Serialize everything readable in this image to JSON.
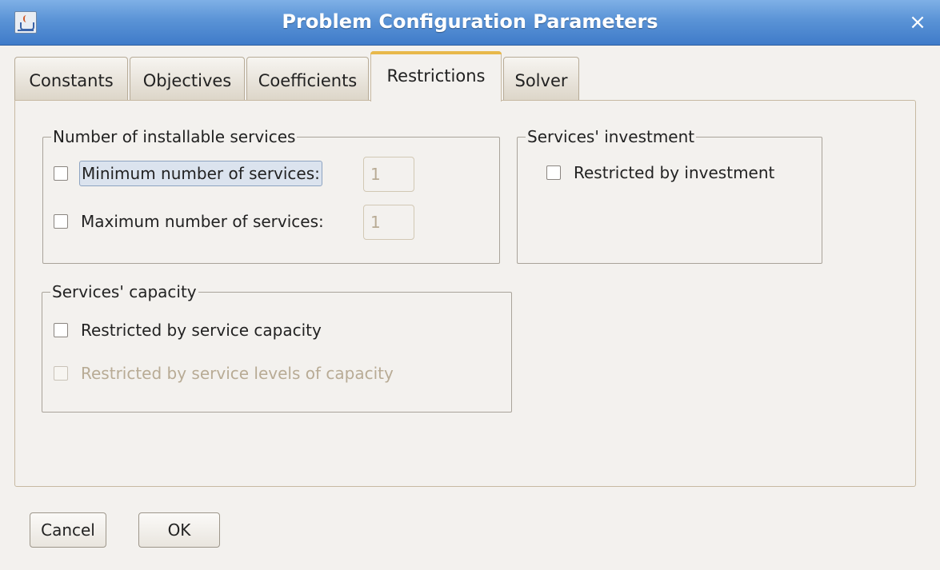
{
  "window": {
    "title": "Problem Configuration Parameters",
    "icon": "java-cup-icon",
    "close_glyph": "×"
  },
  "tabs": [
    {
      "label": "Constants",
      "active": false
    },
    {
      "label": "Objectives",
      "active": false
    },
    {
      "label": "Coefficients",
      "active": false
    },
    {
      "label": "Restrictions",
      "active": true
    },
    {
      "label": "Solver",
      "active": false
    }
  ],
  "groups": {
    "installable": {
      "legend": "Number of installable services",
      "min": {
        "label": "Minimum number of services:",
        "checked": false,
        "value": "1"
      },
      "max": {
        "label": "Maximum number of services:",
        "checked": false,
        "value": "1"
      }
    },
    "investment": {
      "legend": "Services' investment",
      "restricted": {
        "label": "Restricted by investment",
        "checked": false
      }
    },
    "capacity": {
      "legend": "Services' capacity",
      "by_capacity": {
        "label": "Restricted by service capacity",
        "checked": false
      },
      "by_levels": {
        "label": "Restricted by service levels of capacity",
        "checked": false,
        "enabled": false
      }
    }
  },
  "buttons": {
    "cancel": "Cancel",
    "ok": "OK"
  },
  "colors": {
    "titlebar": "#5a93d6",
    "active_tab_accent": "#e8b84a",
    "disabled_text": "#b8ab95",
    "background": "#f3f1ee"
  }
}
